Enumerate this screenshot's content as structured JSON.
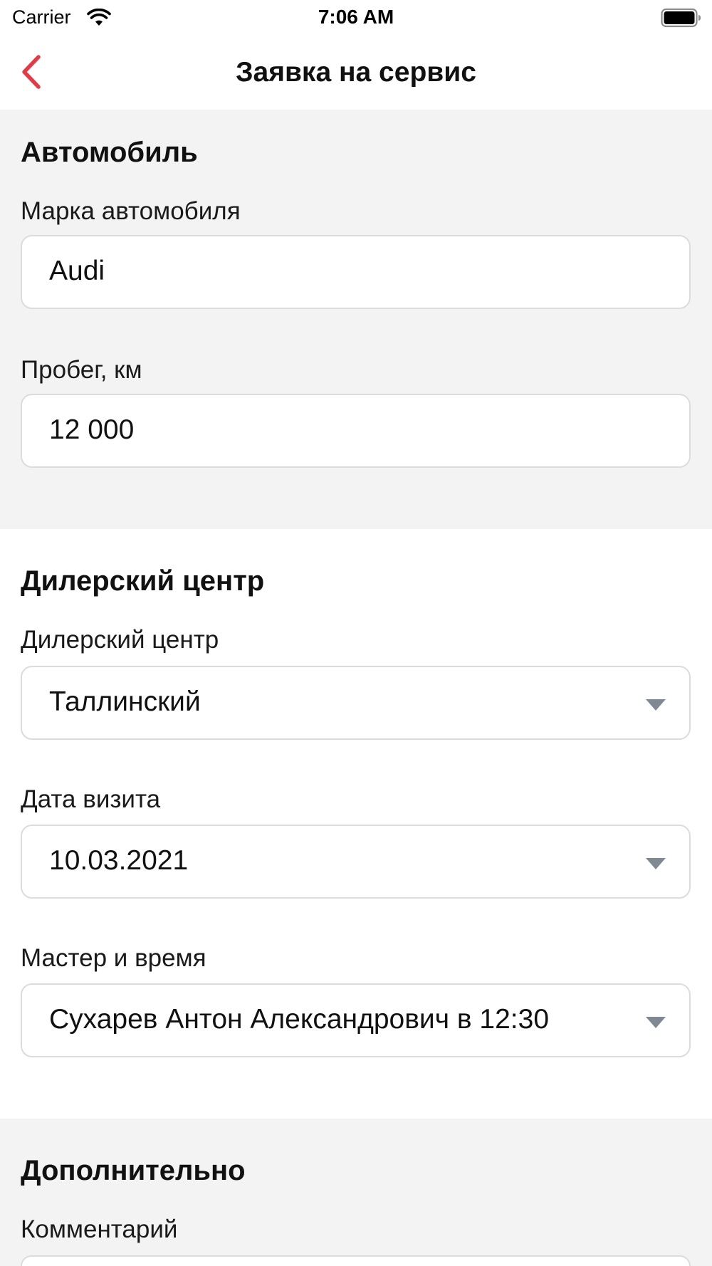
{
  "status_bar": {
    "carrier": "Carrier",
    "time": "7:06 AM",
    "icons": [
      "wifi-icon",
      "battery-icon"
    ]
  },
  "nav": {
    "title": "Заявка на сервис",
    "back_icon": "chevron-left-icon",
    "accent_color": "#e63946"
  },
  "sections": {
    "car": {
      "title": "Автомобиль",
      "brand": {
        "label": "Марка автомобиля",
        "value": "Audi"
      },
      "mileage": {
        "label": "Пробег, км",
        "value": "12 000"
      }
    },
    "dealer": {
      "title": "Дилерский центр",
      "center": {
        "label": "Дилерский центр",
        "value": "Таллинский"
      },
      "date": {
        "label": "Дата визита",
        "value": "10.03.2021"
      },
      "master": {
        "label": "Мастер и время",
        "value": "Сухарев Антон Александрович в 12:30"
      }
    },
    "extra": {
      "title": "Дополнительно",
      "comment": {
        "label": "Комментарий",
        "value": ""
      }
    }
  }
}
